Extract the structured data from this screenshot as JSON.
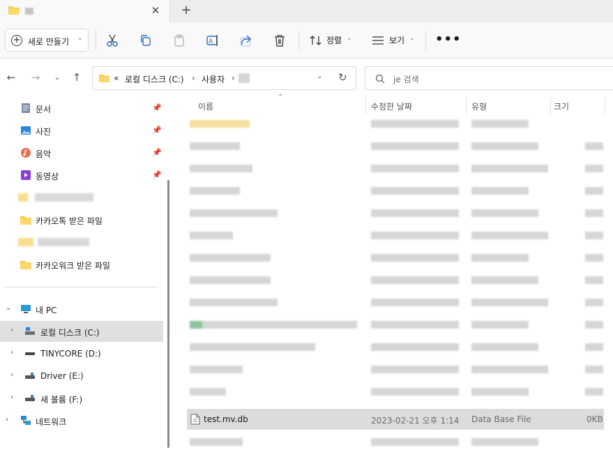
{
  "tab": {
    "close_glyph": "✕",
    "new_glyph": "+"
  },
  "toolbar": {
    "new_label": "새로 만들기",
    "sort_label": "정렬",
    "view_label": "보기",
    "more_glyph": "•••"
  },
  "address": {
    "overflow": "«",
    "crumbs": [
      "로컬 디스크 (C:)",
      "사용자"
    ],
    "separator": "›"
  },
  "search": {
    "placeholder": "je 검색"
  },
  "sidebar": {
    "quick": [
      {
        "label": "문서",
        "icon": "documents-icon"
      },
      {
        "label": "사진",
        "icon": "pictures-icon"
      },
      {
        "label": "음악",
        "icon": "music-icon"
      },
      {
        "label": "동영상",
        "icon": "videos-icon"
      }
    ],
    "folders": [
      "카카오톡 받은 파일",
      "카카오워크 받은 파일"
    ],
    "this_pc": "내 PC",
    "drives": [
      "로컬 디스크 (C:)",
      "TINYCORE (D:)",
      "Driver (E:)",
      "새 볼륨 (F:)"
    ],
    "network": "네트워크"
  },
  "columns": {
    "name": "이름",
    "modified": "수정한 날짜",
    "type": "유형",
    "size": "크기"
  },
  "selected_file": {
    "name": "test.mv.db",
    "modified": "2023-02-21 오후 1:14",
    "type": "Data Base File",
    "size": "0KB"
  },
  "colors": {
    "accent_folder": "#f8c94c",
    "selection": "#dcdcdc"
  }
}
